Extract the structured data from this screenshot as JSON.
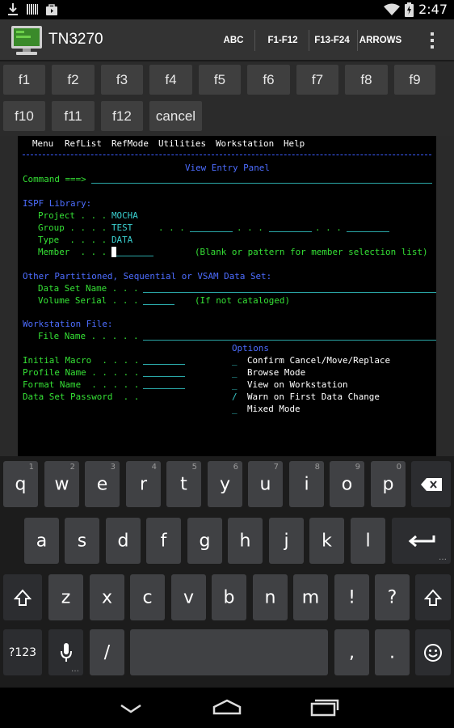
{
  "status_bar": {
    "time": "2:47"
  },
  "app": {
    "title": "TN3270",
    "actions": [
      "ABC",
      "F1-F12",
      "F13-F24",
      "ARROWS"
    ]
  },
  "fkeys": [
    "f1",
    "f2",
    "f3",
    "f4",
    "f5",
    "f6",
    "f7",
    "f8",
    "f9",
    "f10",
    "f11",
    "f12",
    "cancel"
  ],
  "terminal": {
    "menu": [
      "Menu",
      "RefList",
      "RefMode",
      "Utilities",
      "Workstation",
      "Help"
    ],
    "panel_title": "View Entry Panel",
    "command_label": "Command ===>",
    "ispf_library_label": "ISPF Library:",
    "project_label": "Project . . .",
    "project_value": "MOCHA",
    "group_label": "Group . . . .",
    "group_value": "TEST",
    "group_dots": ". . .",
    "type_label": "Type  . . . .",
    "type_value": "DATA",
    "member_label": "Member  . . .",
    "member_hint": "(Blank or pattern for member selection list)",
    "other_ds_label": "Other Partitioned, Sequential or VSAM Data Set:",
    "dsname_label": "Data Set Name . . .",
    "volser_label": "Volume Serial . . .",
    "volser_hint": "(If not cataloged)",
    "ws_file_label": "Workstation File:",
    "file_name_label": "File Name . . . . .",
    "options_label": "Options",
    "initial_macro_label": "Initial Macro  . . . .",
    "profile_name_label": "Profile Name . . . . .",
    "format_name_label": "Format Name  . . . . .",
    "ds_password_label": "Data Set Password  . .",
    "options": [
      {
        "mark": "_",
        "label": "Confirm Cancel/Move/Replace"
      },
      {
        "mark": "_",
        "label": "Browse Mode"
      },
      {
        "mark": "_",
        "label": "View on Workstation"
      },
      {
        "mark": "/",
        "label": "Warn on First Data Change"
      },
      {
        "mark": "_",
        "label": "Mixed Mode"
      }
    ]
  },
  "keyboard": {
    "row1": [
      {
        "k": "q",
        "h": "1"
      },
      {
        "k": "w",
        "h": "2"
      },
      {
        "k": "e",
        "h": "3"
      },
      {
        "k": "r",
        "h": "4"
      },
      {
        "k": "t",
        "h": "5"
      },
      {
        "k": "y",
        "h": "6"
      },
      {
        "k": "u",
        "h": "7"
      },
      {
        "k": "i",
        "h": "8"
      },
      {
        "k": "o",
        "h": "9"
      },
      {
        "k": "p",
        "h": "0"
      }
    ],
    "row2": [
      "a",
      "s",
      "d",
      "f",
      "g",
      "h",
      "j",
      "k",
      "l"
    ],
    "row3": [
      "z",
      "x",
      "c",
      "v",
      "b",
      "n",
      "m",
      "!",
      "?"
    ],
    "symbols_label": "?123",
    "slash": "/",
    "comma": ",",
    "period": "."
  }
}
